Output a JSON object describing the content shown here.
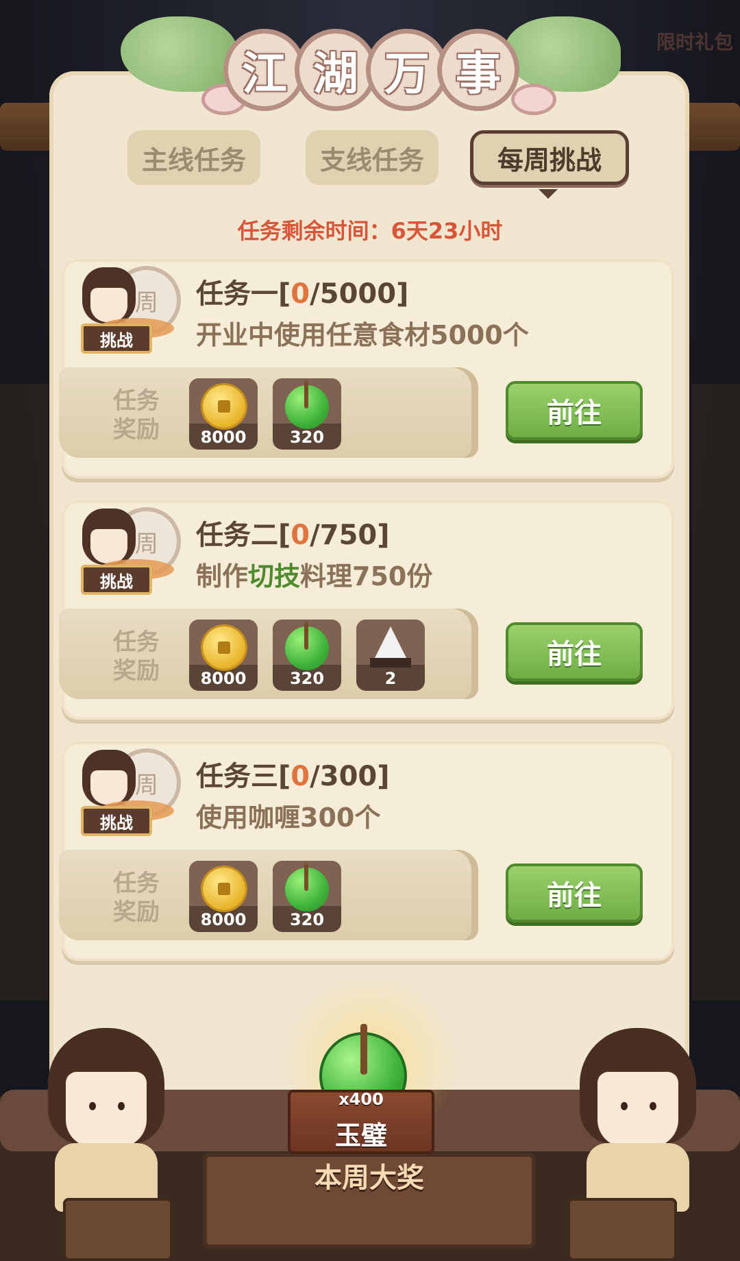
{
  "side_gift": "限时礼包",
  "title_chars": [
    "江",
    "湖",
    "万",
    "事"
  ],
  "tabs": [
    {
      "label": "主线任务",
      "active": false
    },
    {
      "label": "支线任务",
      "active": false
    },
    {
      "label": "每周挑战",
      "active": true
    }
  ],
  "timer_text": "任务剩余时间：6天23小时",
  "badge_label": "挑战",
  "disc_char": "周",
  "reward_label": "任务奖励",
  "go_label": "前往",
  "tasks": [
    {
      "title_prefix": "任务一[",
      "current": "0",
      "title_suffix": "/5000]",
      "desc_pre": "开业中使用任意食材5000个",
      "desc_hl": "",
      "desc_post": "",
      "rewards": [
        {
          "icon": "coin-icon",
          "amount": "8000"
        },
        {
          "icon": "jade-icon",
          "amount": "320"
        }
      ]
    },
    {
      "title_prefix": "任务二[",
      "current": "0",
      "title_suffix": "/750]",
      "desc_pre": "制作",
      "desc_hl": "切技",
      "desc_post": "料理750份",
      "rewards": [
        {
          "icon": "coin-icon",
          "amount": "8000"
        },
        {
          "icon": "jade-icon",
          "amount": "320"
        },
        {
          "icon": "rice-ball-icon",
          "amount": "2"
        }
      ]
    },
    {
      "title_prefix": "任务三[",
      "current": "0",
      "title_suffix": "/300]",
      "desc_pre": "使用咖喱300个",
      "desc_hl": "",
      "desc_post": "",
      "rewards": [
        {
          "icon": "coin-icon",
          "amount": "8000"
        },
        {
          "icon": "jade-icon",
          "amount": "320"
        }
      ]
    }
  ],
  "grand_prize": {
    "quantity": "x400",
    "name": "玉璧",
    "label": "本周大奖"
  },
  "colors": {
    "timer": "#d9553a",
    "progress_current": "#e0743f",
    "highlight": "#4e8a2e",
    "go_button": "#6fae44"
  }
}
